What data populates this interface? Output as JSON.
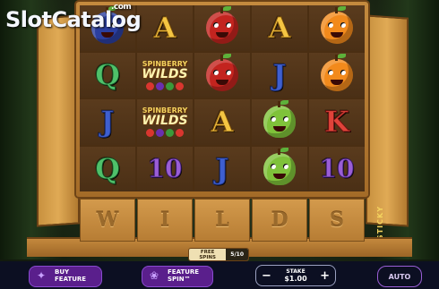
{
  "logo": {
    "text": "SlotCatalog",
    "suffix": ".com"
  },
  "reels": [
    [
      {
        "sym": "plum"
      },
      {
        "sym": "Q"
      },
      {
        "sym": "J"
      },
      {
        "sym": "Q"
      }
    ],
    [
      {
        "sym": "A"
      },
      {
        "sym": "wild"
      },
      {
        "sym": "wild"
      },
      {
        "sym": "10"
      }
    ],
    [
      {
        "sym": "apple"
      },
      {
        "sym": "apple"
      },
      {
        "sym": "A"
      },
      {
        "sym": "J"
      }
    ],
    [
      {
        "sym": "A"
      },
      {
        "sym": "J"
      },
      {
        "sym": "pear"
      },
      {
        "sym": "pear"
      }
    ],
    [
      {
        "sym": "orange"
      },
      {
        "sym": "orange"
      },
      {
        "sym": "K"
      },
      {
        "sym": "10"
      }
    ]
  ],
  "wild_symbol": {
    "line1": "SPINBERRY",
    "line2": "WILDS"
  },
  "wilds_planks": [
    "W",
    "I",
    "L",
    "D",
    "S"
  ],
  "side_label": "STICKY",
  "free_spins": {
    "label": "FREE SPINS",
    "count": "5/10"
  },
  "controls": {
    "buy_feature": "BUY FEATURE",
    "feature_spin": "FEATURE SPIN™",
    "stake_label": "STAKE",
    "stake_value": "$1.00",
    "minus": "−",
    "plus": "+",
    "auto": "AUTO"
  }
}
